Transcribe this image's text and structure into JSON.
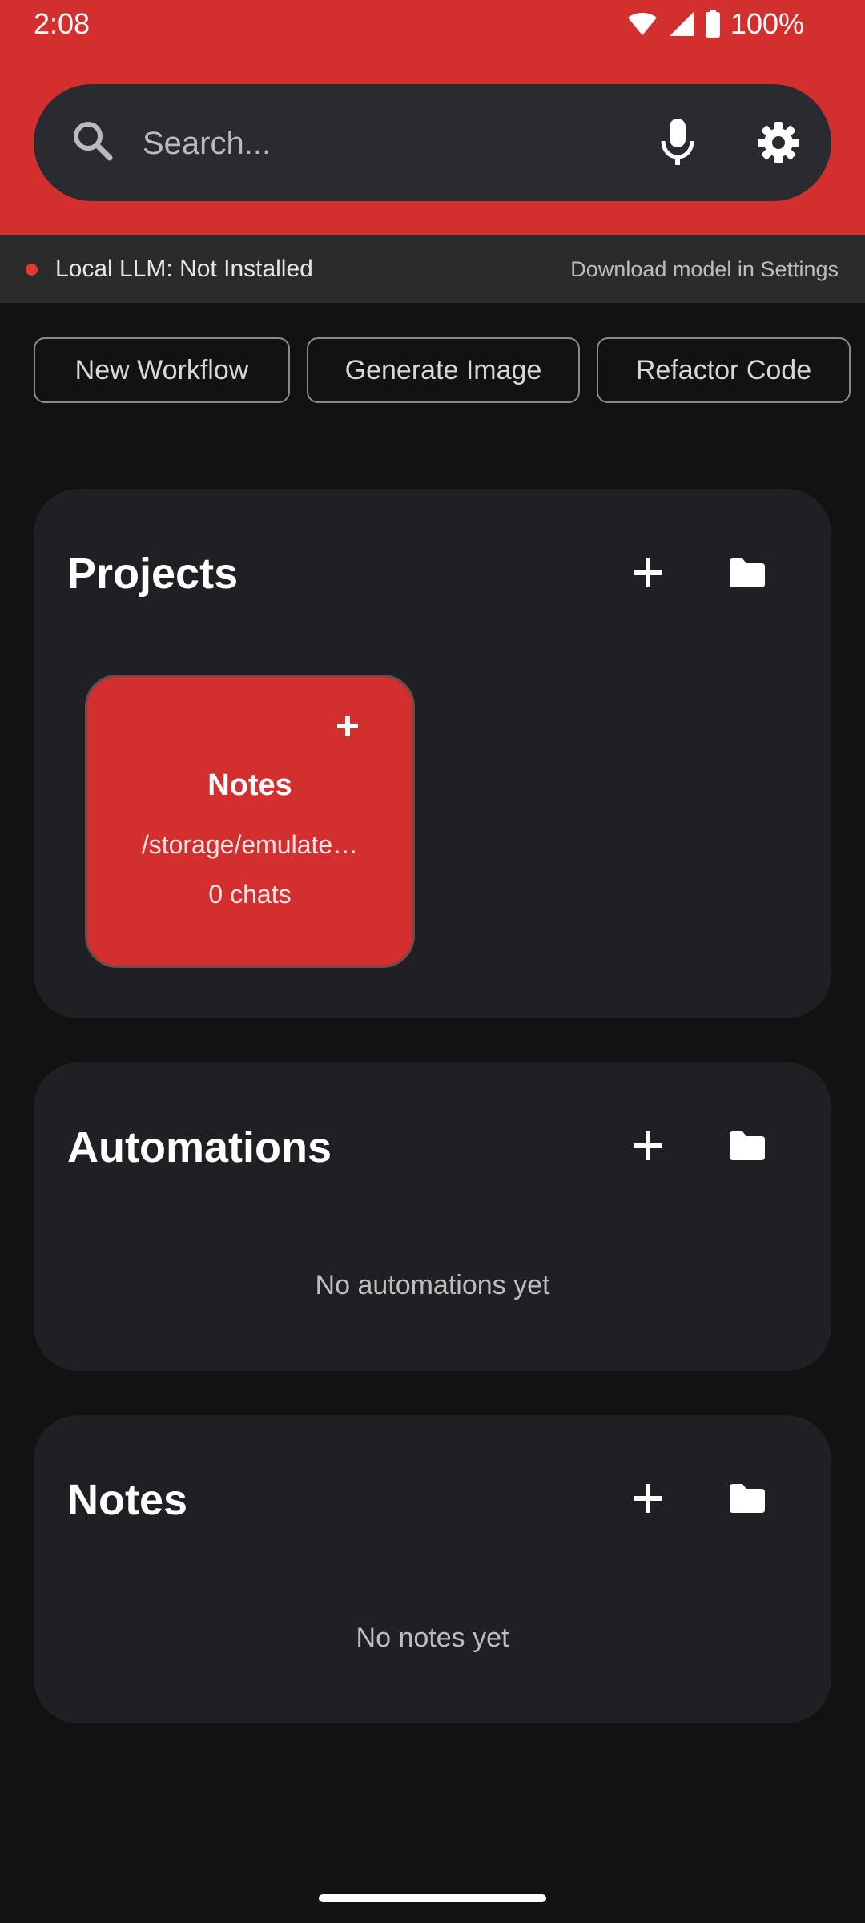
{
  "status_bar": {
    "time": "2:08",
    "battery": "100%"
  },
  "search": {
    "placeholder": "Search..."
  },
  "llm": {
    "status": "Local LLM: Not Installed",
    "hint": "Download model in Settings",
    "status_color": "#e53935"
  },
  "quick_actions": [
    {
      "label": "New Workflow"
    },
    {
      "label": "Generate Image"
    },
    {
      "label": "Refactor Code"
    }
  ],
  "sections": {
    "projects": {
      "title": "Projects",
      "items": [
        {
          "name": "Notes",
          "path": "/storage/emulate…",
          "chats": "0 chats"
        }
      ]
    },
    "automations": {
      "title": "Automations",
      "empty": "No automations yet"
    },
    "notes": {
      "title": "Notes",
      "empty": "No notes yet"
    }
  },
  "colors": {
    "accent": "#d32f2f",
    "background": "#121212",
    "card": "#1f1f24"
  },
  "icons": {
    "search": "search-icon",
    "mic": "mic-icon",
    "settings": "gear-icon",
    "add": "plus-icon",
    "folder": "folder-icon"
  }
}
